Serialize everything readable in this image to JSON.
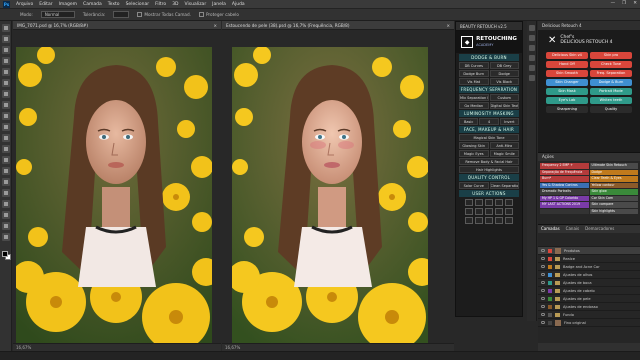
{
  "app": {
    "logo": "Ps"
  },
  "menu": [
    "Arquivo",
    "Editar",
    "Imagem",
    "Camada",
    "Texto",
    "Selecionar",
    "Filtro",
    "3D",
    "Visualizar",
    "Janela",
    "Ajuda"
  ],
  "options_bar": {
    "mode_label": "Modo:",
    "mode_value": "Normal",
    "flow_label": "Tolerância:",
    "flow_value": "",
    "sample_all": "Mostrar Todas Camad.",
    "check_label": "Proteger cabelo"
  },
  "documents": [
    {
      "tab": "IMG_7071.psd @ 16,7% (RGB/8#)",
      "status": "16,67%"
    },
    {
      "tab": "Estoucendo de pele (38).psd @ 16,7% (Frequência, RGB/8)",
      "status": "16,67%"
    }
  ],
  "retouch_panel": {
    "header": "BEAUTY RETOUCH v2.5",
    "logo_line1": "RETOUCHING",
    "logo_line2": "ACADEMY",
    "sections": [
      {
        "title": "DODGE & BURN",
        "rows": [
          [
            "DB Curves",
            "DB Grey"
          ],
          [
            "Dodge Burn",
            "Dodge"
          ],
          [
            "Vis Mat",
            "Vis Black"
          ]
        ]
      },
      {
        "title": "FREQUENCY SEPARATION",
        "rows": [
          [
            "Mix Separation Blur",
            "Custom"
          ],
          [
            "Go Median",
            "Digital Skin Texture"
          ]
        ]
      },
      {
        "title": "LUMINOSITY MASKING",
        "rows": [
          [
            "Basic",
            "4",
            "Invert"
          ]
        ]
      },
      {
        "title": "FACE, MAKEUP & HAIR",
        "rows": [
          [
            "Magical Skin Tone"
          ],
          [
            "Glowing Skin",
            "Anti-Mira"
          ],
          [
            "Magic Eyes",
            "Magic Smile"
          ],
          [
            "Remove Body & Facial Hair"
          ],
          [
            "Hair Highlights"
          ]
        ]
      },
      {
        "title": "QUALITY CONTROL",
        "rows": [
          [
            "Solar Curve",
            "Clean Separation"
          ]
        ]
      },
      {
        "title": "USER ACTIONS",
        "rows": []
      }
    ]
  },
  "chef_panel": {
    "header": "Delicious Retouch 4",
    "logo_x": "✕",
    "logo_title": "Chef's",
    "logo_sub": "DELICIOUS RETOUCH 4",
    "buttons": [
      {
        "label": "Delicious Skin v4",
        "color": "#d9463b"
      },
      {
        "label": "Skin pro",
        "color": "#d9463b"
      },
      {
        "label": "Hand Off",
        "color": "#d9463b"
      },
      {
        "label": "Check Tone",
        "color": "#d9463b"
      },
      {
        "label": "Skin Smooth",
        "color": "#d9463b"
      },
      {
        "label": "Freq. Separation",
        "color": "#d9463b"
      },
      {
        "label": "Skin Changer",
        "color": "#3f8fd1"
      },
      {
        "label": "Dodge & Burn",
        "color": "#3f8fd1"
      },
      {
        "label": "Skin Mask",
        "color": "#2f9a8a"
      },
      {
        "label": "Portrait Mode",
        "color": "#2f9a8a"
      },
      {
        "label": "Eye's Lab",
        "color": "#2f9a8a"
      },
      {
        "label": "Whiten teeth",
        "color": "#2f9a8a"
      },
      {
        "label": "Sharpening",
        "color": "#2b2b2b"
      },
      {
        "label": "Quality",
        "color": "#2b2b2b"
      }
    ]
  },
  "actions_panel": {
    "header": "Ações",
    "items": [
      {
        "label": "Frequency 2 EMP +",
        "color": "#b43b3b"
      },
      {
        "label": "Ultimate Skin Retouch",
        "color": "#4a4a4a"
      },
      {
        "label": "Separação de Frequência",
        "color": "#b43b3b"
      },
      {
        "label": "Dodge",
        "color": "#c07a1c"
      },
      {
        "label": "Burn*",
        "color": "#b43b3b"
      },
      {
        "label": "Clear Teeth & Eyes",
        "color": "#c07a1c"
      },
      {
        "label": "Yes & Shadow Contras",
        "color": "#3b6fb4"
      },
      {
        "label": "Yellow contour",
        "color": "#8a5a2a"
      },
      {
        "label": "Dramatic Portraits",
        "color": "#3b3b3b"
      },
      {
        "label": "Skin glow",
        "color": "#3a8a3a"
      },
      {
        "label": "My HP 1 & GP Colorido",
        "color": "#7a3ba8"
      },
      {
        "label": "Cor Skin Cam",
        "color": "#4a4a4a"
      },
      {
        "label": "MY LAST ACTIONS 2019",
        "color": "#7a3ba8"
      },
      {
        "label": "Skin compare",
        "color": "#4a4a4a"
      },
      {
        "label": "",
        "color": "#333"
      },
      {
        "label": "Skin highlights",
        "color": "#4a4a4a"
      }
    ]
  },
  "layers_panel": {
    "tabs": [
      "Camadas",
      "Canais",
      "Demarcadores"
    ],
    "layers": [
      {
        "name": "Produtos",
        "kind": "thumb",
        "sw": "#d9463b"
      },
      {
        "name": "Realce",
        "kind": "fold",
        "sw": "#d9463b"
      },
      {
        "name": "Badge and Acne Cor",
        "kind": "fold",
        "sw": "#c07a1c"
      },
      {
        "name": "Ajustes de olhos",
        "kind": "fold",
        "sw": "#3f8fd1"
      },
      {
        "name": "Ajustes de boca",
        "kind": "fold",
        "sw": "#2f9a8a"
      },
      {
        "name": "Ajustes de cabelo",
        "kind": "fold",
        "sw": "#7a3ba8"
      },
      {
        "name": "Ajustes de pele",
        "kind": "fold",
        "sw": "#3a8a3a"
      },
      {
        "name": "Ajustes de endosso",
        "kind": "fold",
        "sw": "#8a5a2a"
      },
      {
        "name": "Fundo",
        "kind": "fold",
        "sw": "#555"
      },
      {
        "name": "Fino original",
        "kind": "thumb",
        "sw": "#444"
      }
    ]
  },
  "window_controls": [
    "—",
    "❐",
    "✕"
  ]
}
